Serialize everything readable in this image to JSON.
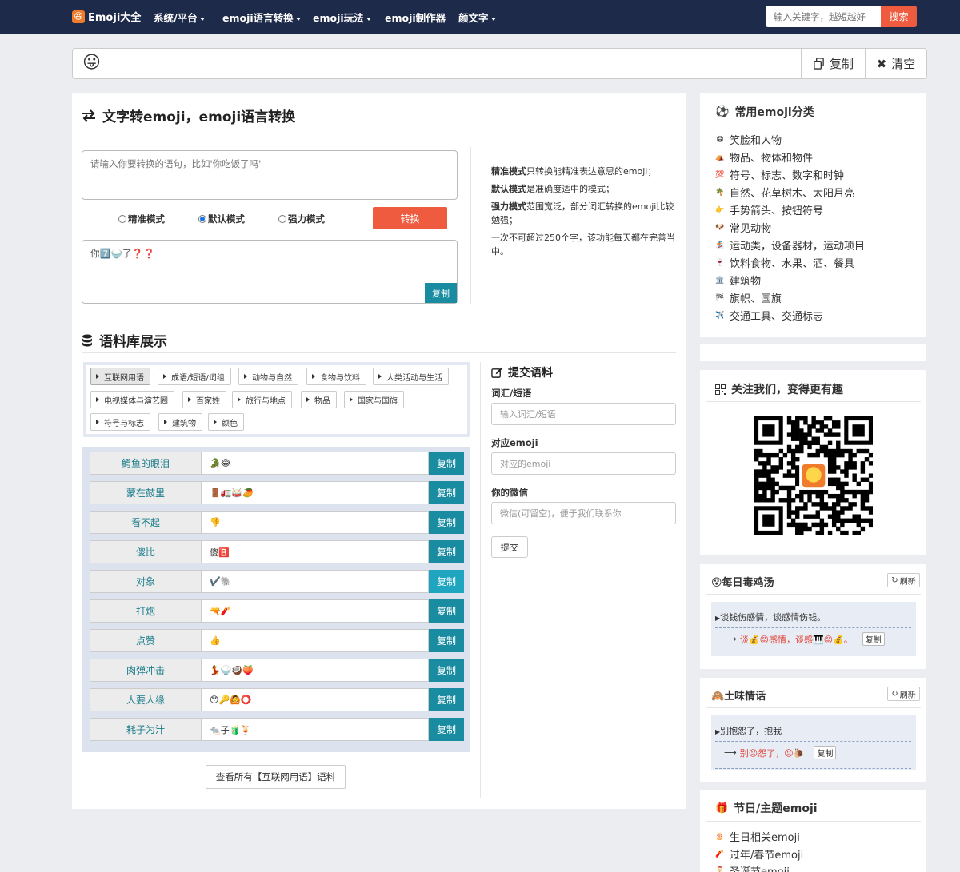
{
  "nav": {
    "brand": "Emoji大全",
    "items": [
      "系统/平台",
      "emoji语言转换",
      "emoji玩法",
      "emoji制作器",
      "颜文字"
    ],
    "search_placeholder": "输入关键字，越短越好",
    "search_button": "搜索"
  },
  "emoji_bar": {
    "current": "😛",
    "copy_label": "复制",
    "clear_label": "清空"
  },
  "converter": {
    "title": "文字转emoji，emoji语言转换",
    "input_placeholder": "请输入你要转换的语句，比如'你吃饭了吗'",
    "modes": [
      "精准模式",
      "默认模式",
      "强力模式"
    ],
    "selected_mode": 1,
    "convert_button": "转换",
    "output_text": "你7️⃣🍚了❓❓",
    "output_copy": "复制",
    "desc": [
      {
        "bold": "精准模式",
        "text": "只转换能精准表达意思的emoji；"
      },
      {
        "bold": "默认模式",
        "text": "是准确度适中的模式；"
      },
      {
        "bold": "强力模式",
        "text": "范围宽泛，部分词汇转换的emoji比较勉强；"
      },
      {
        "bold": "",
        "text": "一次不可超过250个字，该功能每天都在完善当中。"
      }
    ]
  },
  "corpus": {
    "title": "语料库展示",
    "tags": [
      "互联网用语",
      "成语/短语/词组",
      "动物与自然",
      "食物与饮料",
      "人类活动与生活",
      "电视媒体与演艺圈",
      "百家姓",
      "旅行与地点",
      "物品",
      "国家与国旗",
      "符号与标志",
      "建筑物",
      "颜色"
    ],
    "rows": [
      {
        "term": "鳄鱼的眼泪",
        "emoji": "🐊😂"
      },
      {
        "term": "蒙在鼓里",
        "emoji": "🚪🚛🥁🥭"
      },
      {
        "term": "看不起",
        "emoji": "👎"
      },
      {
        "term": "傻比",
        "emoji": "傻🅱️"
      },
      {
        "term": "对象",
        "emoji": "✔️🐘"
      },
      {
        "term": "打炮",
        "emoji": "🔫🧨"
      },
      {
        "term": "点赞",
        "emoji": "👍"
      },
      {
        "term": "肉弹冲击",
        "emoji": "💃🍚🥥🍑"
      },
      {
        "term": "人要人缘",
        "emoji": "😯🔑🙆⭕"
      },
      {
        "term": "耗子为汁",
        "emoji": "🐀子🧃🍹"
      }
    ],
    "copy_label": "复制",
    "view_all": "查看所有【互联网用语】语料"
  },
  "submit_form": {
    "title": "提交语料",
    "word_label": "词汇/短语",
    "word_placeholder": "输入词汇/短语",
    "emoji_label": "对应emoji",
    "emoji_placeholder": "对应的emoji",
    "wechat_label": "你的微信",
    "wechat_placeholder": "微信(可留空)，便于我们联系你",
    "submit": "提交"
  },
  "categories": {
    "title": "常用emoji分类",
    "items": [
      {
        "icon": "😀",
        "label": "笑脸和人物"
      },
      {
        "icon": "⛺",
        "label": "物品、物体和物件"
      },
      {
        "icon": "💯",
        "label": "符号、标志、数字和时钟"
      },
      {
        "icon": "🌴",
        "label": "自然、花草树木、太阳月亮"
      },
      {
        "icon": "👉",
        "label": "手势箭头、按钮符号"
      },
      {
        "icon": "🐶",
        "label": "常见动物"
      },
      {
        "icon": "🏂",
        "label": "运动类，设备器材，运动项目"
      },
      {
        "icon": "🍷",
        "label": "饮料食物、水果、酒、餐具"
      },
      {
        "icon": "🏛️",
        "label": "建筑物"
      },
      {
        "icon": "🏁",
        "label": "旗帜、国旗"
      },
      {
        "icon": "✈️",
        "label": "交通工具、交通标志"
      }
    ]
  },
  "follow": {
    "title": "关注我们，变得更有趣"
  },
  "daily_soup": {
    "title": "😵每日毒鸡汤",
    "refresh": "刷新",
    "text": "谈钱伤感情，谈感情伤钱。",
    "emoji_text": "谈💰😡感情，谈感🎹😡💰。",
    "copy": "复制"
  },
  "love_talk": {
    "title": "🙈土味情话",
    "refresh": "刷新",
    "text": "别抱怨了，抱我",
    "emoji_text": "别😡怨了，😡🐌",
    "copy": "复制"
  },
  "festival": {
    "title": "节日/主题emoji",
    "items": [
      {
        "icon": "🎂",
        "label": "生日相关emoji"
      },
      {
        "icon": "🧨",
        "label": "过年/春节emoji"
      },
      {
        "icon": "🎅",
        "label": "圣诞节emoji"
      }
    ]
  }
}
